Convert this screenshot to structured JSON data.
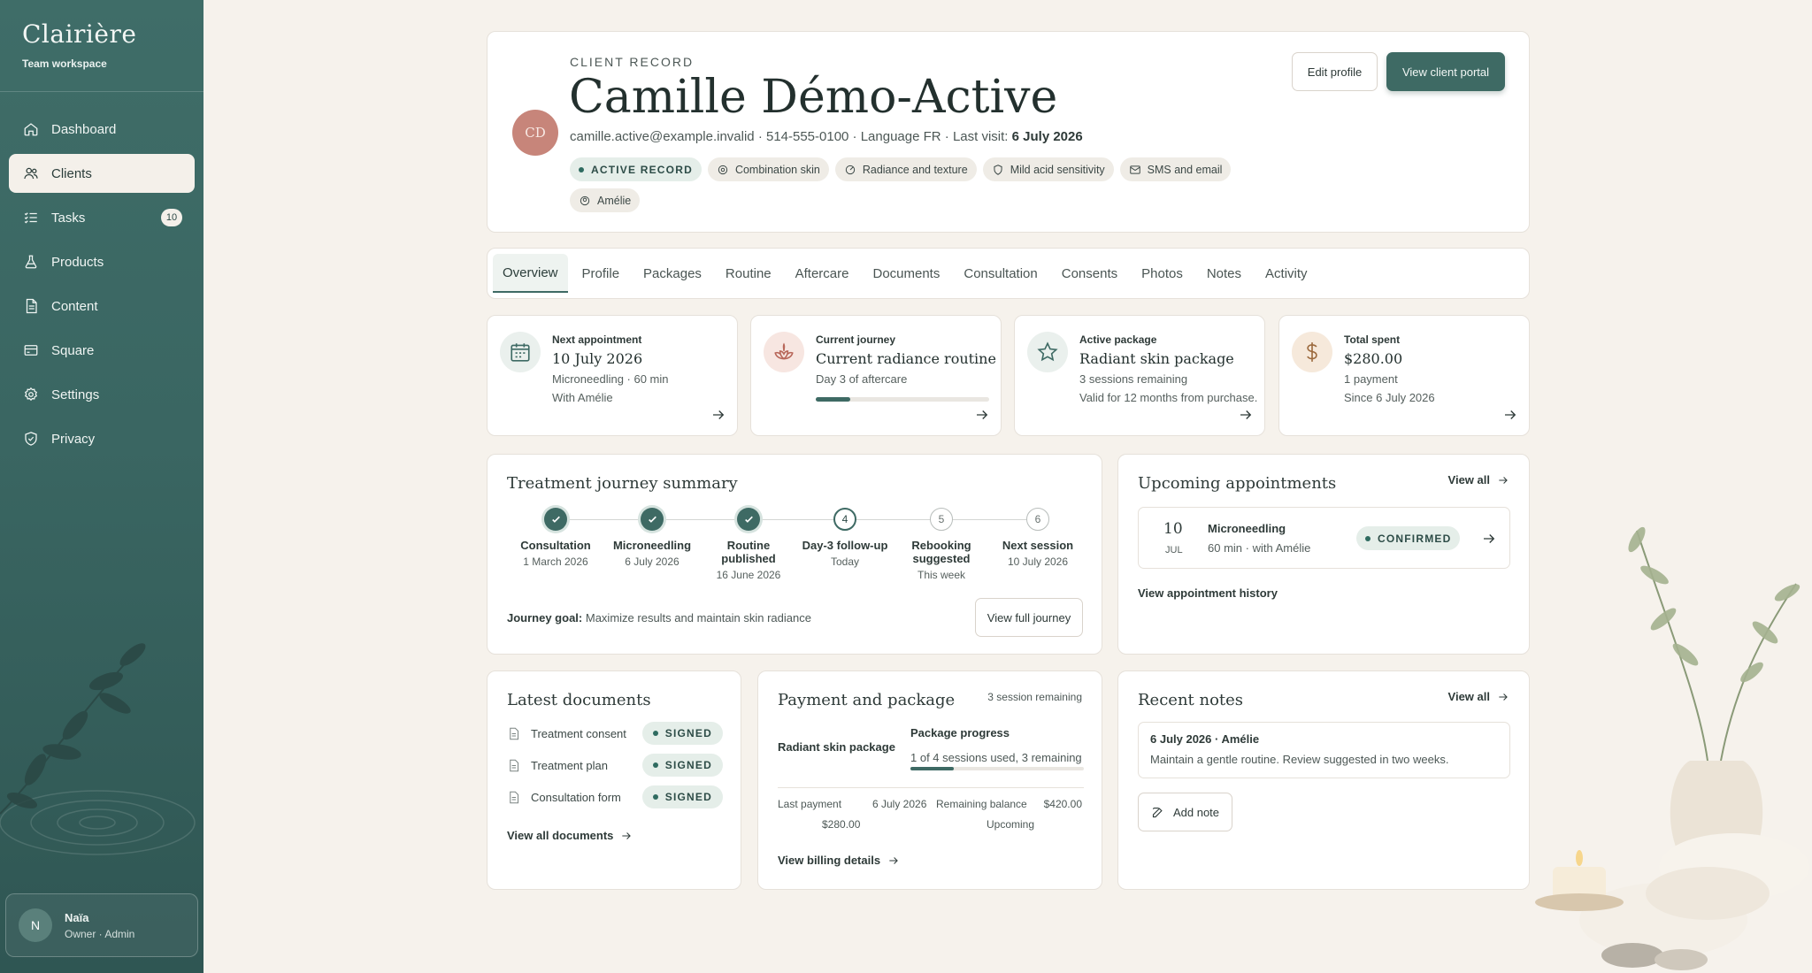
{
  "sidebar": {
    "brand": "Clairière",
    "workspace": "Team workspace",
    "items": [
      {
        "label": "Dashboard"
      },
      {
        "label": "Clients"
      },
      {
        "label": "Tasks",
        "badge": "10"
      },
      {
        "label": "Products"
      },
      {
        "label": "Content"
      },
      {
        "label": "Square"
      },
      {
        "label": "Settings"
      },
      {
        "label": "Privacy"
      }
    ],
    "user": {
      "initial": "N",
      "name": "Naïa",
      "role": "Owner · Admin"
    }
  },
  "header": {
    "eyebrow": "CLIENT RECORD",
    "name": "Camille Démo-Active",
    "initials": "CD",
    "meta": "camille.active@example.invalid · 514-555-0100 · Language FR · Last visit:",
    "last_visit": "6 July 2026",
    "chips": {
      "active": "ACTIVE RECORD",
      "skin": "Combination skin",
      "goal": "Radiance and texture",
      "sensitivity": "Mild acid sensitivity",
      "contact": "SMS and email",
      "practitioner": "Amélie"
    },
    "edit_label": "Edit profile",
    "portal_label": "View client portal"
  },
  "tabs": [
    "Overview",
    "Profile",
    "Packages",
    "Routine",
    "Aftercare",
    "Documents",
    "Consultation",
    "Consents",
    "Photos",
    "Notes",
    "Activity"
  ],
  "stats": {
    "appointment": {
      "label": "Next appointment",
      "value": "10 July 2026",
      "line1": "Microneedling · 60 min",
      "line2": "With Amélie"
    },
    "journey": {
      "label": "Current journey",
      "value": "Current radiance routine",
      "line1": "Day 3 of aftercare",
      "progress": 0.2
    },
    "package": {
      "label": "Active package",
      "value": "Radiant skin package",
      "line1": "3 sessions remaining",
      "line2": "Valid for 12 months from purchase."
    },
    "spent": {
      "label": "Total spent",
      "value": "$280.00",
      "line1": "1 payment",
      "line2": "Since 6 July 2026"
    }
  },
  "journey_summary": {
    "title": "Treatment journey summary",
    "steps": [
      {
        "num": "",
        "title": "Consultation",
        "date": "1 March 2026",
        "state": "done"
      },
      {
        "num": "",
        "title": "Microneedling",
        "date": "6 July 2026",
        "state": "done"
      },
      {
        "num": "",
        "title": "Routine published",
        "date": "16 June 2026",
        "state": "done"
      },
      {
        "num": "4",
        "title": "Day-3 follow-up",
        "date": "Today",
        "state": "current"
      },
      {
        "num": "5",
        "title": "Rebooking suggested",
        "date": "This week",
        "state": "future"
      },
      {
        "num": "6",
        "title": "Next session",
        "date": "10 July 2026",
        "state": "future"
      }
    ],
    "goal_label": "Journey goal:",
    "goal_text": "Maximize results and maintain skin radiance",
    "button": "View full journey"
  },
  "upcoming": {
    "title": "Upcoming appointments",
    "view_all": "View all",
    "appt": {
      "day": "10",
      "month": "JUL",
      "service": "Microneedling",
      "detail": "60 min · with Amélie",
      "status": "CONFIRMED"
    },
    "history_link": "View appointment history"
  },
  "documents": {
    "title": "Latest documents",
    "items": [
      {
        "name": "Treatment consent",
        "status": "SIGNED"
      },
      {
        "name": "Treatment plan",
        "status": "SIGNED"
      },
      {
        "name": "Consultation form",
        "status": "SIGNED"
      }
    ],
    "view_all": "View all documents"
  },
  "payment": {
    "title": "Payment and package",
    "remaining_note": "3 session remaining",
    "package_name": "Radiant skin package",
    "progress_label": "Package progress",
    "progress_text": "1 of 4 sessions used, 3 remaining",
    "progress": 0.25,
    "last_payment_label": "Last payment",
    "last_payment_date": "6 July 2026",
    "last_payment_amount": "$280.00",
    "balance_label": "Remaining balance",
    "balance_amount": "$420.00",
    "balance_status": "Upcoming",
    "billing_link": "View billing details"
  },
  "notes": {
    "title": "Recent notes",
    "view_all": "View all",
    "note_head": "6 July 2026 · Amélie",
    "note_body": "Maintain a gentle routine. Review suggested in two weeks.",
    "add_label": "Add note"
  }
}
